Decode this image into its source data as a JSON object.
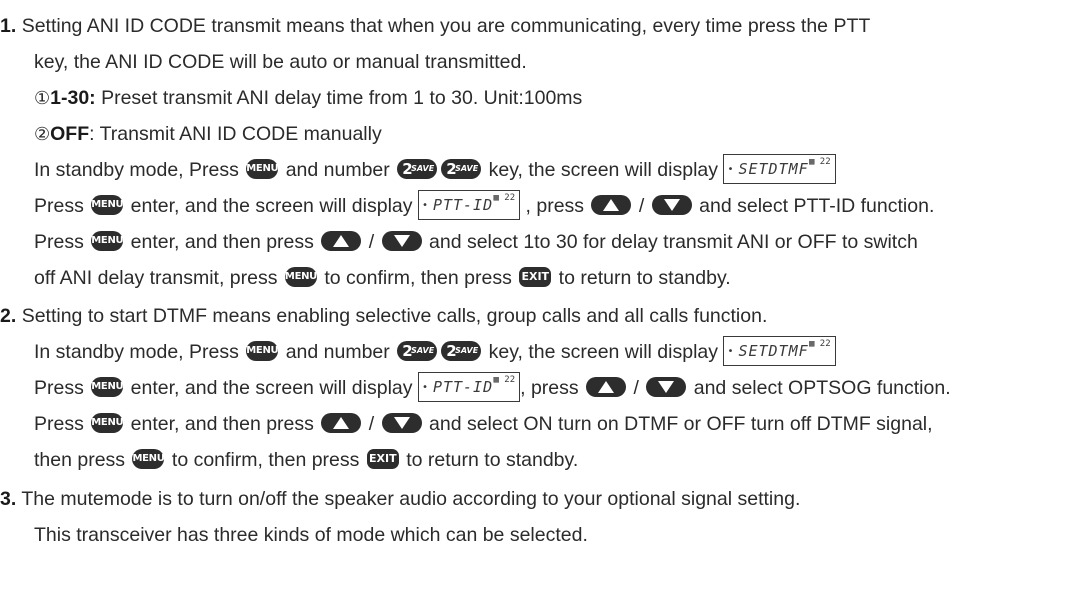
{
  "items": [
    {
      "number": "1.",
      "lines": [
        "Setting ANI ID CODE transmit means that when you are communicating, every time press the PTT",
        "key, the ANI ID CODE will be auto or manual transmitted."
      ],
      "options": [
        {
          "marker": "①",
          "label": "1-30:",
          "text": " Preset transmit ANI delay time from 1 to 30. Unit:100ms"
        },
        {
          "marker": "②",
          "label": "OFF",
          "text": ": Transmit ANI ID CODE manually"
        }
      ],
      "steps": {
        "s1": {
          "a": "In standby mode, Press ",
          "b": " and number ",
          "c": " key, the screen will display "
        },
        "s2": {
          "a": "Press ",
          "b": " enter, and the screen will display ",
          "c": " , press ",
          "d": " / ",
          "e": " and select PTT-ID function."
        },
        "s3": {
          "a": "Press ",
          "b": " enter, and then press ",
          "c": " / ",
          "d": " and select 1to 30 for delay transmit ANI or OFF to switch"
        },
        "s4": {
          "a": "off ANI delay transmit, press ",
          "b": " to confirm, then press ",
          "c": " to return to standby."
        }
      }
    },
    {
      "number": "2.",
      "lines": [
        "Setting to start DTMF means enabling selective calls, group calls and all calls function."
      ],
      "steps": {
        "s1": {
          "a": "In standby mode, Press ",
          "b": " and number ",
          "c": " key, the screen will display "
        },
        "s2": {
          "a": "Press ",
          "b": " enter, and the screen will display ",
          "c": ", press ",
          "d": " / ",
          "e": " and select OPTSOG function."
        },
        "s3": {
          "a": "Press ",
          "b": " enter, and then press ",
          "c": " / ",
          "d": " and select ON turn on DTMF or OFF turn off DTMF signal,"
        },
        "s4": {
          "a": "then press ",
          "b": " to confirm, then press ",
          "c": " to return to standby."
        }
      }
    },
    {
      "number": "3.",
      "lines": [
        "The mutemode is to turn on/off the speaker audio according to your optional signal setting.",
        "This transceiver has three kinds of mode which can be selected."
      ]
    }
  ],
  "keys": {
    "menu": "MENU",
    "exit": "EXIT",
    "two": "2",
    "two_sub": "SAVE"
  },
  "lcd": {
    "setdtmf": "SETDTMF",
    "pttid": "PTT-ID",
    "tick": "•",
    "icon": "▦ 22"
  }
}
